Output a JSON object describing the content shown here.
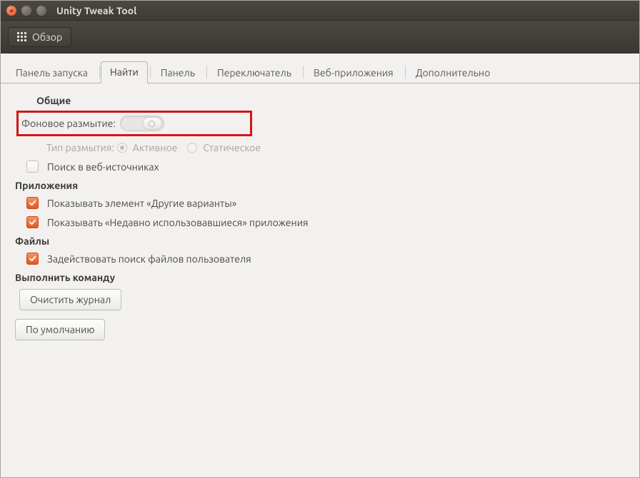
{
  "window": {
    "title": "Unity Tweak Tool"
  },
  "toolbar": {
    "overview_label": "Обзор"
  },
  "tabs": {
    "launcher": "Панель запуска",
    "search": "Найти",
    "panel": "Панель",
    "switcher": "Переключатель",
    "webapps": "Веб-приложения",
    "additional": "Дополнительно",
    "active": "search"
  },
  "sections": {
    "general": {
      "title": "Общие",
      "background_blur_label": "Фоновое размытие:",
      "blur_type_label": "Тип размытия:",
      "blur_type_active": "Активное",
      "blur_type_static": "Статическое",
      "search_web_label": "Поиск в веб-источниках"
    },
    "apps": {
      "title": "Приложения",
      "show_more_label": "Показывать элемент «Другие варианты»",
      "show_recent_label": "Показывать «Недавно использовавшиеся» приложения"
    },
    "files": {
      "title": "Файлы",
      "user_file_search_label": "Задействовать поиск файлов пользователя"
    },
    "run": {
      "title": "Выполнить команду",
      "clear_history_label": "Очистить журнал"
    }
  },
  "footer": {
    "restore_defaults_label": "По умолчанию"
  }
}
